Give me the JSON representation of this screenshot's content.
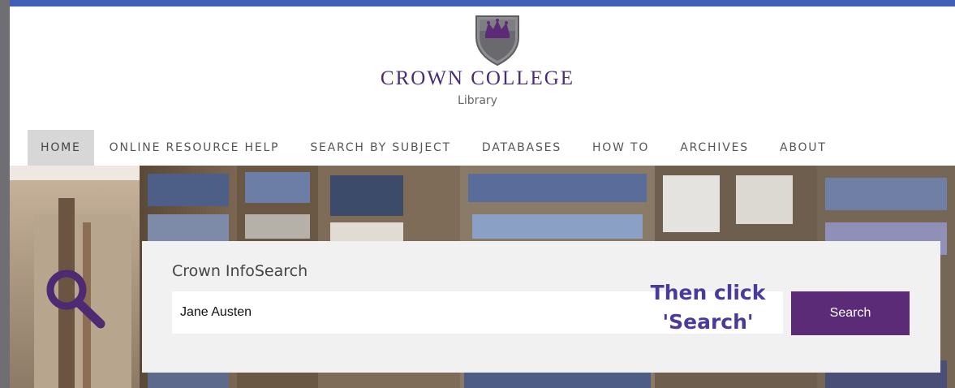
{
  "brand": {
    "name": "CROWN COLLEGE",
    "subtitle": "Library",
    "primary_color": "#5b2b78",
    "top_bar_color": "#3f5fb8"
  },
  "nav": {
    "items": [
      {
        "label": "HOME",
        "active": true
      },
      {
        "label": "ONLINE RESOURCE HELP"
      },
      {
        "label": "SEARCH BY SUBJECT"
      },
      {
        "label": "DATABASES"
      },
      {
        "label": "HOW TO"
      },
      {
        "label": "ARCHIVES"
      },
      {
        "label": "ABOUT"
      }
    ]
  },
  "search": {
    "title": "Crown InfoSearch",
    "query": "Jane Austen",
    "button_label": "Search",
    "icon": "magnifier-icon"
  },
  "annotation": {
    "line1": "Then click",
    "line2": "'Search'",
    "color": "#4b3a9c"
  }
}
